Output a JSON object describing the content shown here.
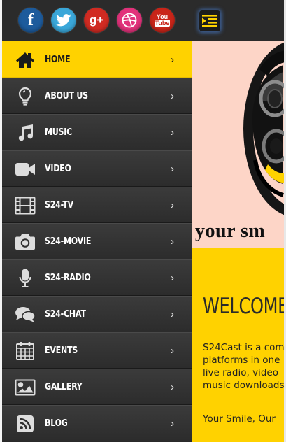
{
  "social": [
    {
      "name": "facebook",
      "glyph": "f",
      "color": "#1d5b9c"
    },
    {
      "name": "twitter",
      "glyph": "",
      "color": "#3aa7d9"
    },
    {
      "name": "google-plus",
      "glyph": "g+",
      "color": "#d12b22"
    },
    {
      "name": "dribbble",
      "glyph": "",
      "color": "#e2327b"
    },
    {
      "name": "youtube",
      "glyph_line1": "You",
      "glyph_line2": "Tube",
      "color": "#c92519"
    }
  ],
  "menu": {
    "items": [
      {
        "label": "HOME",
        "icon": "home-icon",
        "active": true
      },
      {
        "label": "ABOUT US",
        "icon": "lightbulb-icon"
      },
      {
        "label": "MUSIC",
        "icon": "music-note-icon"
      },
      {
        "label": "VIDEO",
        "icon": "video-camera-icon"
      },
      {
        "label": "S24-TV",
        "icon": "film-icon"
      },
      {
        "label": "S24-MOVIE",
        "icon": "camera-icon"
      },
      {
        "label": "S24-RADIO",
        "icon": "microphone-icon"
      },
      {
        "label": "S24-CHAT",
        "icon": "chat-bubbles-icon"
      },
      {
        "label": "EVENTS",
        "icon": "calendar-icon"
      },
      {
        "label": "GALLERY",
        "icon": "picture-icon"
      },
      {
        "label": "BLOG",
        "icon": "rss-icon"
      }
    ],
    "chevron": "›"
  },
  "content": {
    "hero_tagline": "your sm",
    "welcome": "WELCOME",
    "intro": "S24Cast is a com\nplatforms in one\nlive radio, video\nmusic downloads",
    "motto": "Your Smile, Our"
  },
  "colors": {
    "accent": "#ffd200",
    "panel": "#2a2a2a",
    "hero_bg": "#fdd5c7"
  }
}
